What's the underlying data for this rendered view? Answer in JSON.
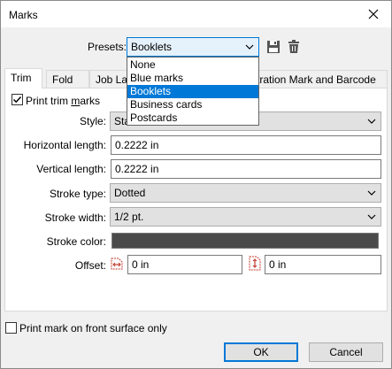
{
  "window": {
    "title": "Marks"
  },
  "presets": {
    "label": "Presets:",
    "selected": "Booklets",
    "options": [
      "None",
      "Blue marks",
      "Booklets",
      "Business cards",
      "Postcards"
    ],
    "highlighted_index": 2
  },
  "tabs": [
    {
      "label": "Trim",
      "active": true
    },
    {
      "label": "Fold",
      "active": false
    },
    {
      "label": "Job La",
      "active": false
    },
    {
      "label": "tration Mark and Barcode",
      "active": false
    }
  ],
  "trim": {
    "print_trim_marks": {
      "label_pre": "Print trim ",
      "label_u": "m",
      "label_post": "arks",
      "checked": true
    },
    "style": {
      "label": "Style:",
      "value": "Sta"
    },
    "horizontal_length": {
      "label": "Horizontal length:",
      "value": "0.2222 in"
    },
    "vertical_length": {
      "label": "Vertical length:",
      "value": "0.2222 in"
    },
    "stroke_type": {
      "label": "Stroke type:",
      "value": "Dotted"
    },
    "stroke_width": {
      "label": "Stroke width:",
      "value": "1/2 pt."
    },
    "stroke_color": {
      "label": "Stroke color:",
      "color": "#4a4a4a"
    },
    "offset": {
      "label": "Offset:",
      "horizontal_value": "0 in",
      "vertical_value": "0 in"
    }
  },
  "footer": {
    "front_surface": {
      "label": "Print mark on front surface only",
      "checked": false
    },
    "ok_label": "OK",
    "cancel_label": "Cancel"
  },
  "colors": {
    "accent": "#0078d7",
    "offset_icon": "#c0392b"
  }
}
